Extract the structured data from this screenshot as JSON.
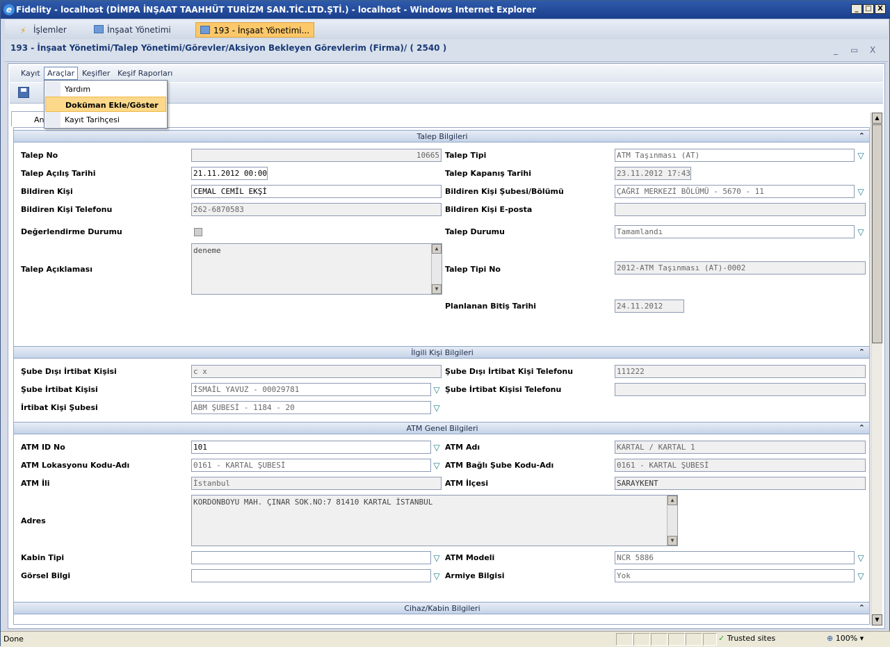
{
  "window": {
    "title": "Fidelity - localhost (DİMPA İNŞAAT TAAHHÜT TURİZM SAN.TİC.LTD.ŞTİ.) - localhost - Windows Internet Explorer",
    "min": "_",
    "max": "□",
    "close": "X"
  },
  "tabs": [
    {
      "label": "İşlemler"
    },
    {
      "label": "İnşaat Yönetimi"
    },
    {
      "label": "193 - İnşaat Yönetimi..."
    }
  ],
  "breadcrumb": "193 - İnşaat Yönetimi/Talep Yönetimi/Görevler/Aksiyon Bekleyen Görevlerim (Firma)/ ( 2540 )",
  "panel_controls": {
    "min": "_",
    "max": "▭",
    "close": "X"
  },
  "menu": [
    "Kayıt",
    "Araçlar",
    "Keşifler",
    "Keşif Raporları"
  ],
  "dropdown": [
    "Yardım",
    "Doküman Ekle/Göster",
    "Kayıt Tarihçesi"
  ],
  "form_tab": "An",
  "sections": {
    "talep": "Talep Bilgileri",
    "ilgili": "İlgili Kişi Bilgileri",
    "atm": "ATM Genel Bilgileri",
    "cihaz": "Cihaz/Kabin Bilgileri"
  },
  "talep": {
    "no_label": "Talep No",
    "no": "10665",
    "tipi_label": "Talep Tipi",
    "tipi": "ATM Taşınması (AT)",
    "acilis_label": "Talep Açılış Tarihi",
    "acilis": "21.11.2012 00:00",
    "kapanis_label": "Talep Kapanış Tarihi",
    "kapanis": "23.11.2012 17:43",
    "bildiren_label": "Bildiren Kişi",
    "bildiren": "CEMAL CEMİL EKŞİ",
    "sube_label": "Bildiren Kişi Şubesi/Bölümü",
    "sube": "ÇAĞRI MERKEZİ BÖLÜMÜ - 5670 - 11",
    "tel_label": "Bildiren Kişi Telefonu",
    "tel": "262-6870583",
    "eposta_label": "Bildiren Kişi E-posta",
    "eposta": "",
    "deger_label": "Değerlendirme Durumu",
    "durum_label": "Talep Durumu",
    "durum": "Tamamlandı",
    "aciklama_label": "Talep Açıklaması",
    "aciklama": "deneme",
    "tipino_label": "Talep Tipi No",
    "tipino": "2012-ATM Taşınması (AT)-0002",
    "plan_label": "Planlanan Bitiş Tarihi",
    "plan": "24.11.2012"
  },
  "ilgili": {
    "disi_label": "Şube Dışı İrtibat Kişisi",
    "disi": "c x",
    "disi_tel_label": "Şube Dışı İrtibat Kişi Telefonu",
    "disi_tel": "111222",
    "sube_kisi_label": "Şube İrtibat Kişisi",
    "sube_kisi": "İSMAİL YAVUZ - 00029781",
    "sube_tel_label": "Şube İrtibat Kişisi Telefonu",
    "sube_tel": "",
    "irtibat_sube_label": "İrtibat Kişi Şubesi",
    "irtibat_sube": "ABM ŞUBESİ - 1184 - 20"
  },
  "atm": {
    "id_label": "ATM ID No",
    "id": "101",
    "adi_label": "ATM Adı",
    "adi": "KARTAL / KARTAL 1",
    "lok_label": "ATM Lokasyonu Kodu-Adı",
    "lok": "0161 - KARTAL ŞUBESİ",
    "bagli_label": "ATM Bağlı Şube Kodu-Adı",
    "bagli": "0161 - KARTAL ŞUBESİ",
    "il_label": "ATM İli",
    "il": "İstanbul",
    "ilce_label": "ATM İlçesi",
    "ilce": "SARAYKENT",
    "adres_label": "Adres",
    "adres": "KORDONBOYU MAH. ÇINAR SOK.NO:7 81410 KARTAL  İSTANBUL",
    "kabin_label": "Kabin Tipi",
    "kabin": "",
    "model_label": "ATM Modeli",
    "model": "NCR 5886",
    "gorsel_label": "Görsel Bilgi",
    "gorsel": "",
    "armiye_label": "Armiye Bilgisi",
    "armiye": "Yok"
  },
  "status": {
    "text": "Done",
    "trusted": "Trusted sites",
    "zoom": "100%"
  }
}
